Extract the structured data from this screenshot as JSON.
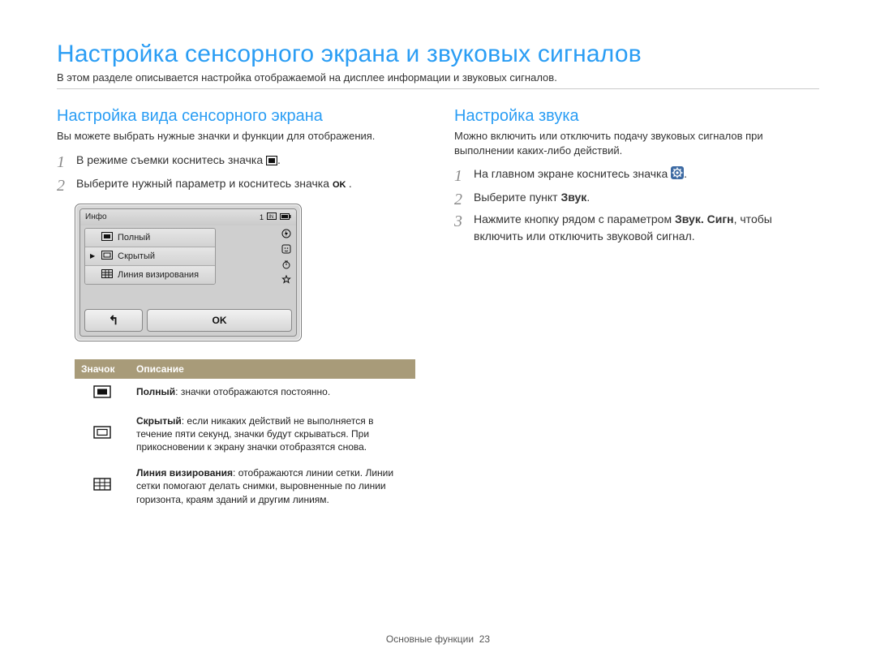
{
  "page_title": "Настройка сенсорного экрана и звуковых сигналов",
  "intro": "В этом разделе описывается настройка отображаемой на дисплее информации и звуковых сигналов.",
  "left": {
    "heading": "Настройка вида сенсорного экрана",
    "lead": "Вы можете выбрать нужные значки и функции для отображения.",
    "step1a": "В режиме съемки коснитесь значка ",
    "step1b": ".",
    "step2a": "Выберите нужный параметр и коснитесь значка ",
    "step2b": "."
  },
  "device": {
    "header_label": "Инфо",
    "status_count": "1",
    "row_full": "Полный",
    "row_hidden": "Скрытый",
    "row_grid": "Линия визирования",
    "ok_label": "OK"
  },
  "table": {
    "head_icon": "Значок",
    "head_desc": "Описание",
    "full_bold": "Полный",
    "full_text": ": значки отображаются постоянно.",
    "hidden_bold": "Скрытый",
    "hidden_text": ": если никаких действий не выполняется в течение пяти секунд, значки будут скрываться. При прикосновении к экрану значки отобразятся снова.",
    "grid_bold": "Линия визирования",
    "grid_text": ": отображаются линии сетки. Линии сетки помогают делать снимки, выровненные по линии горизонта, краям зданий и другим линиям."
  },
  "right": {
    "heading": "Настройка звука",
    "lead": "Можно включить или отключить подачу звуковых сигналов при выполнении каких-либо действий.",
    "step1a": "На главном экране коснитесь значка ",
    "step1b": ".",
    "step2a": "Выберите пункт ",
    "step2b": "Звук",
    "step2c": ".",
    "step3a": "Нажмите кнопку рядом с параметром ",
    "step3b": "Звук. Сигн",
    "step3c": ", чтобы включить или отключить звуковой сигнал."
  },
  "footer_section": "Основные функции",
  "footer_page": "23"
}
